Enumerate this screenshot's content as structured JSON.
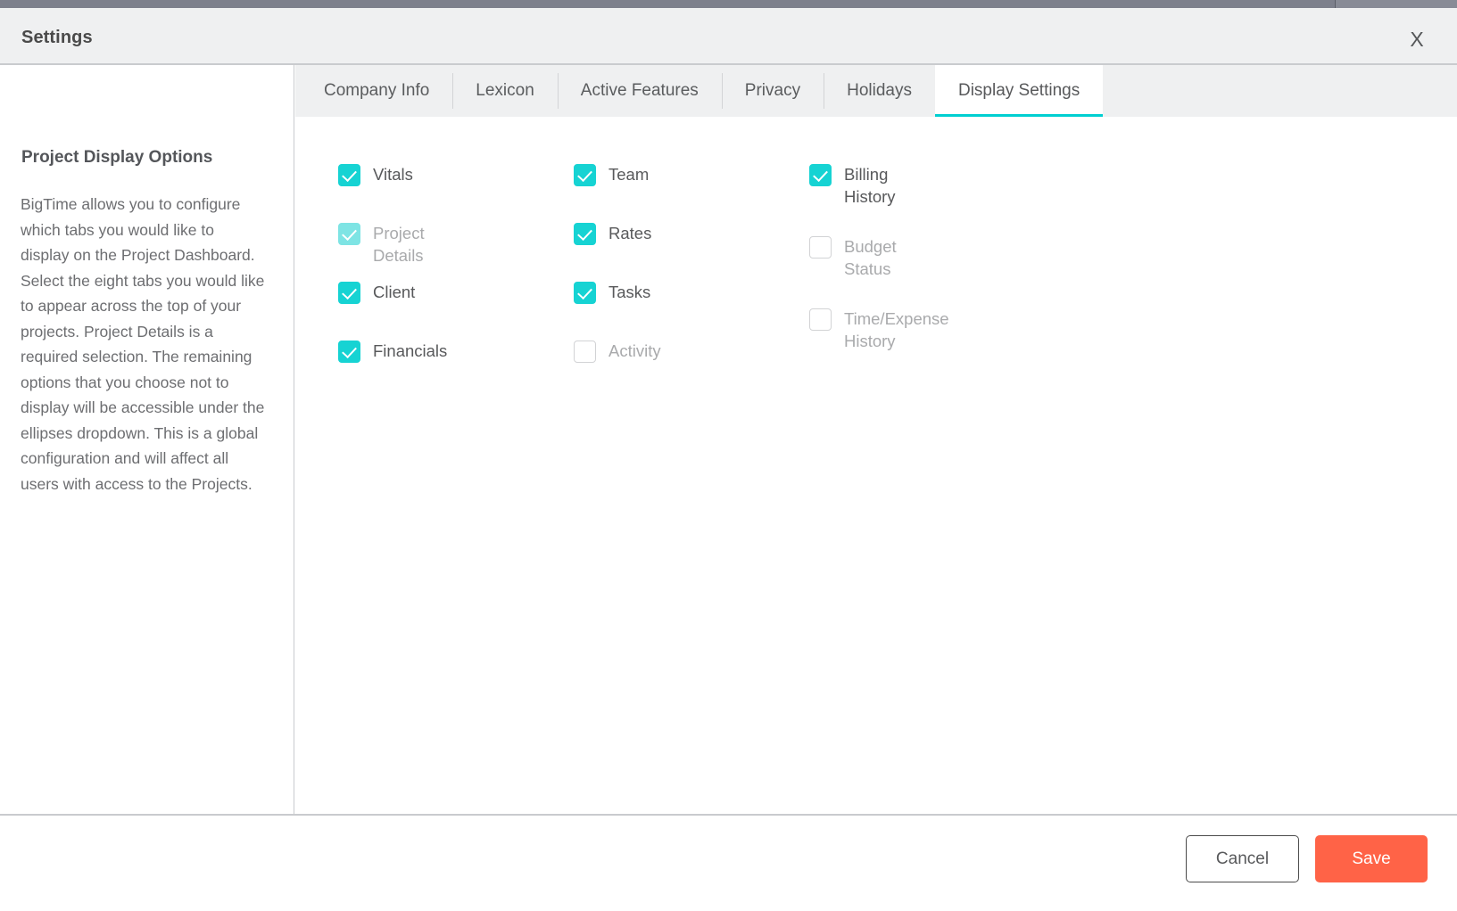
{
  "window": {
    "title": "Settings",
    "close_label": "X"
  },
  "tabs": [
    {
      "label": "Company Info",
      "active": false
    },
    {
      "label": "Lexicon",
      "active": false
    },
    {
      "label": "Active Features",
      "active": false
    },
    {
      "label": "Privacy",
      "active": false
    },
    {
      "label": "Holidays",
      "active": false
    },
    {
      "label": "Display Settings",
      "active": true
    }
  ],
  "sidebar": {
    "title": "Project Display Options",
    "paragraph": "BigTime allows you to configure which tabs you would like to display on the Project Dashboard. Select the eight tabs you would like to appear across the top of your projects. Project Details is a required selection. The remaining options that you choose not to display will be accessible under the ellipses dropdown. This is a global configuration and will affect all users with access to the Projects."
  },
  "options": {
    "column_1": [
      {
        "label": "Vitals",
        "checked": true,
        "disabled": false
      },
      {
        "label": "Project Details",
        "checked": true,
        "disabled": true
      },
      {
        "label": "Client",
        "checked": true,
        "disabled": false
      },
      {
        "label": "Financials",
        "checked": true,
        "disabled": false
      }
    ],
    "column_2": [
      {
        "label": "Team",
        "checked": true,
        "disabled": false
      },
      {
        "label": "Rates",
        "checked": true,
        "disabled": false
      },
      {
        "label": "Tasks",
        "checked": true,
        "disabled": false
      },
      {
        "label": "Activity",
        "checked": false,
        "disabled": true
      }
    ],
    "column_3": [
      {
        "label": "Billing History",
        "checked": true,
        "disabled": false
      },
      {
        "label": "Budget Status",
        "checked": false,
        "disabled": true
      },
      {
        "label": "Time/Expense History",
        "checked": false,
        "disabled": true
      }
    ]
  },
  "footer": {
    "cancel_label": "Cancel",
    "save_label": "Save"
  },
  "colors": {
    "accent_teal": "#16d3d3",
    "accent_teal_disabled": "#7ee4e4",
    "save_orange": "#ff6347",
    "header_bg": "#eff0f1",
    "topbar": "#7d808c"
  }
}
